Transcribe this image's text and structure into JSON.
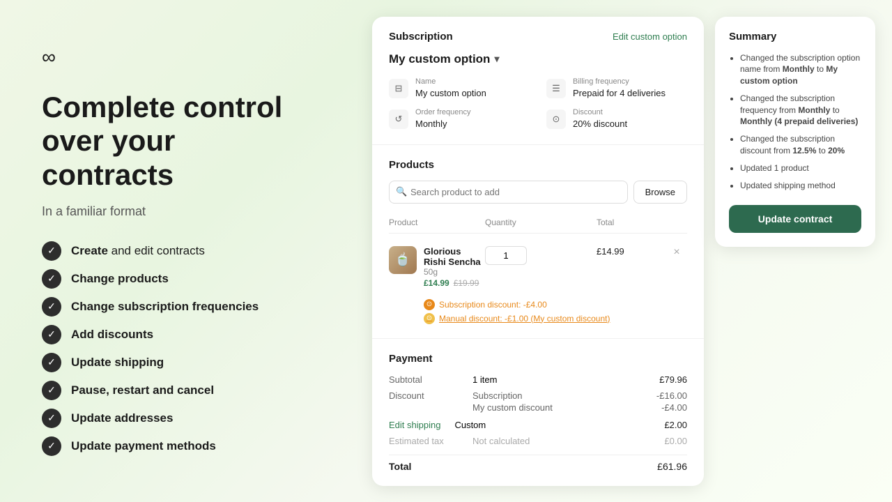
{
  "logo": {
    "symbol": "∞"
  },
  "hero": {
    "title": "Complete control over your contracts",
    "subtitle": "In a familiar format"
  },
  "features": [
    {
      "label": "Create",
      "suffix": " and edit contracts"
    },
    {
      "label": "Change products",
      "suffix": ""
    },
    {
      "label": "Change subscription frequencies",
      "suffix": ""
    },
    {
      "label": "Add discounts",
      "suffix": ""
    },
    {
      "label": "Update shipping",
      "suffix": ""
    },
    {
      "label": "Pause, restart and cancel",
      "suffix": ""
    },
    {
      "label": "Update addresses",
      "suffix": ""
    },
    {
      "label": "Update payment methods",
      "suffix": ""
    }
  ],
  "subscription": {
    "section_title": "Subscription",
    "edit_link": "Edit custom option",
    "selected_option": "My custom option",
    "name_label": "Name",
    "name_value": "My custom option",
    "billing_label": "Billing frequency",
    "billing_value": "Prepaid for 4 deliveries",
    "order_label": "Order frequency",
    "order_value": "Monthly",
    "discount_label": "Discount",
    "discount_value": "20% discount"
  },
  "products": {
    "section_title": "Products",
    "search_placeholder": "Search product to add",
    "browse_label": "Browse",
    "col_product": "Product",
    "col_quantity": "Quantity",
    "col_total": "Total",
    "items": [
      {
        "name": "Glorious Rishi Sencha",
        "variant": "50g",
        "price_current": "£14.99",
        "price_original": "£19.99",
        "quantity": "1",
        "total": "£14.99",
        "subscription_discount": "Subscription discount: -£4.00",
        "manual_discount": "Manual discount: -£1.00 (My custom discount)"
      }
    ]
  },
  "payment": {
    "section_title": "Payment",
    "subtotal_label": "Subtotal",
    "subtotal_items": "1 item",
    "subtotal_amount": "£79.96",
    "discount_label": "Discount",
    "discount_sub1_label": "Subscription",
    "discount_sub1_amount": "-£16.00",
    "discount_sub2_label": "My custom discount",
    "discount_sub2_amount": "-£4.00",
    "shipping_label": "Edit shipping",
    "shipping_type": "Custom",
    "shipping_amount": "£2.00",
    "tax_label": "Estimated tax",
    "tax_status": "Not calculated",
    "tax_amount": "£0.00",
    "total_label": "Total",
    "total_amount": "£61.96"
  },
  "summary": {
    "title": "Summary",
    "items": [
      "Changed the subscription option name from <b>Monthly</b> to <b>My custom option</b>",
      "Changed the subscription frequency from <b>Monthly</b> to <b>Monthly (4 prepaid deliveries)</b>",
      "Changed the subscription discount from <b>12.5%</b> to <b>20%</b>",
      "Updated 1 product",
      "Updated shipping method"
    ],
    "update_button": "Update contract"
  }
}
